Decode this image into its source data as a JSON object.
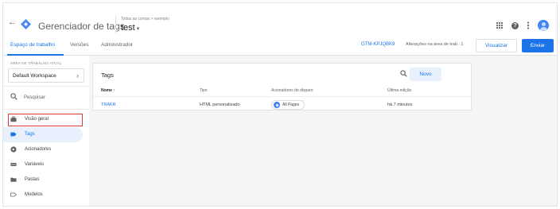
{
  "appbar": {
    "back_icon": "arrow-left-icon",
    "title": "Gerenciador de tags",
    "breadcrumb": "Todas as contas > exemplo",
    "container_name": "test",
    "container_caret": "▾",
    "icons": [
      "apps-grid-icon",
      "help-icon",
      "more-vert-icon",
      "account-avatar-icon"
    ]
  },
  "tabs": {
    "items": [
      {
        "label": "Espaço de trabalho"
      },
      {
        "label": "Versões"
      },
      {
        "label": "Administrador"
      }
    ],
    "gtm_id": "GTM-KPJQBK9",
    "changes_text": "Alterações na área de trab.: 1",
    "preview_label": "Visualizar",
    "submit_label": "Enviar"
  },
  "sidebar": {
    "workspace_label": "ÁREA DE TRABALHO ATUAL",
    "workspace_name": "Default Workspace",
    "workspace_chevron": "›",
    "search_placeholder": "Pesquisar",
    "items": [
      {
        "label": "Visão geral",
        "icon": "briefcase-icon"
      },
      {
        "label": "Tags",
        "icon": "tag-icon"
      },
      {
        "label": "Acionadores",
        "icon": "trigger-icon"
      },
      {
        "label": "Variáveis",
        "icon": "variables-icon"
      },
      {
        "label": "Pastas",
        "icon": "folder-icon"
      },
      {
        "label": "Modelos",
        "icon": "template-icon"
      }
    ]
  },
  "tags_panel": {
    "title": "Tags",
    "new_button": "Novo",
    "columns": [
      "Nome ↑",
      "Tipo",
      "Acionadores de disparo",
      "Última edição"
    ],
    "rows": [
      {
        "name": "TRAKR",
        "type": "HTML personalizado",
        "trigger": "All Pages",
        "edited": "há 7 minutos"
      }
    ]
  },
  "colors": {
    "accent": "#1a73e8",
    "highlight_box": "#e53935",
    "active_nav_bg": "#e8f0fe"
  }
}
